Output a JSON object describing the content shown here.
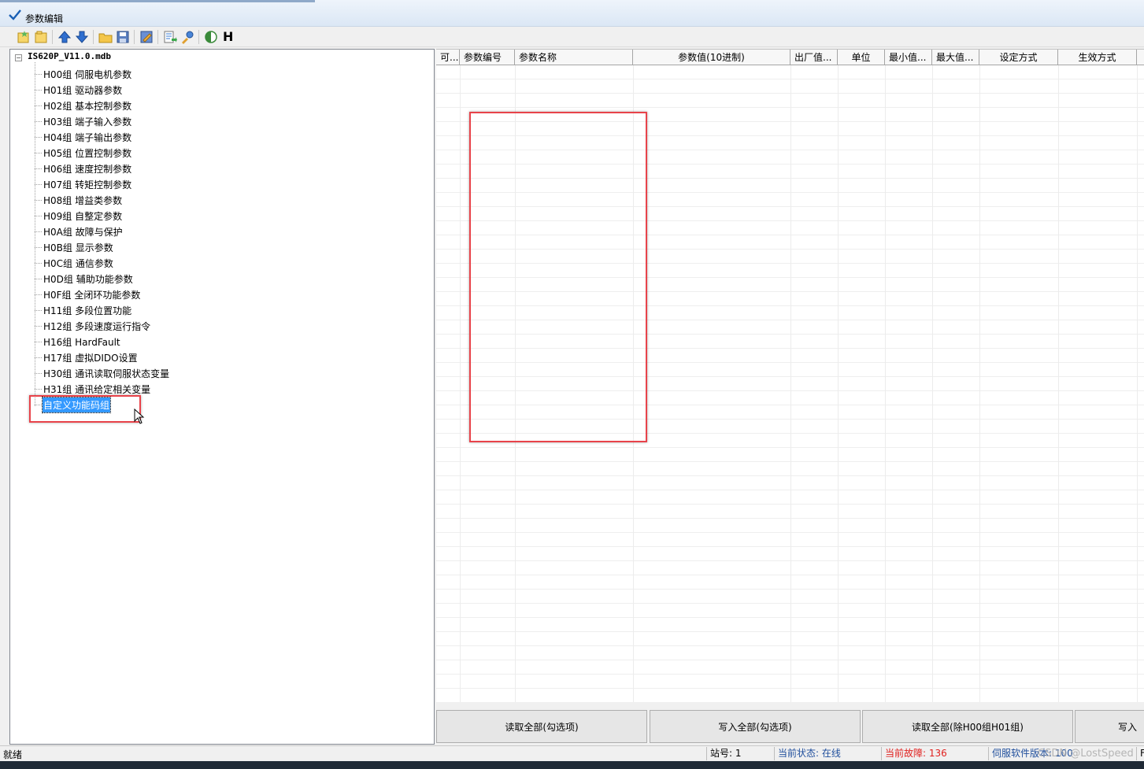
{
  "window": {
    "title": "参数编辑"
  },
  "toolbar": {
    "h_label": "H",
    "buttons": [
      "new-icon",
      "open-folder-icon",
      "arrow-up-icon",
      "arrow-down-icon",
      "folder-icon",
      "save-icon",
      "edit-icon",
      "export-icon",
      "tools-icon",
      "contrast-icon"
    ]
  },
  "tree": {
    "root": "IS620P_V11.0.mdb",
    "root_toggle": "−",
    "items": [
      "H00组 伺服电机参数",
      "H01组 驱动器参数",
      "H02组 基本控制参数",
      "H03组 端子输入参数",
      "H04组 端子输出参数",
      "H05组 位置控制参数",
      "H06组 速度控制参数",
      "H07组 转矩控制参数",
      "H08组 增益类参数",
      "H09组 自整定参数",
      "H0A组 故障与保护",
      "H0B组 显示参数",
      "H0C组 通信参数",
      "H0D组 辅助功能参数",
      "H0F组 全闭环功能参数",
      "H11组 多段位置功能",
      "H12组 多段速度运行指令",
      "H16组 HardFault",
      "H17组 虚拟DIDO设置",
      "H30组 通讯读取伺服状态变量",
      "H31组 通讯给定相关变量",
      "自定义功能码组"
    ],
    "selected_index": 21
  },
  "grid": {
    "columns": [
      "可...",
      "参数编号",
      "参数名称",
      "参数值(10进制)",
      "出厂值...",
      "单位",
      "最小值...",
      "最大值...",
      "设定方式",
      "生效方式"
    ]
  },
  "buttons": {
    "read_all_checked": "读取全部(勾选项)",
    "write_all_checked": "写入全部(勾选项)",
    "read_all_except": "读取全部(除H00组H01组)",
    "write_partial": "写入"
  },
  "status": {
    "ready": "就绪",
    "station": "站号: 1",
    "state": "当前状态: 在线",
    "fault": "当前故障: 136",
    "software": "伺服软件版本: 100",
    "extra": "F",
    "watermark": "CSDN @LostSpeed"
  },
  "colors": {
    "selection": "#3399ff",
    "highlight_box": "#e8434a",
    "fault_text": "#e0201e",
    "state_text": "#1f4e9c"
  }
}
